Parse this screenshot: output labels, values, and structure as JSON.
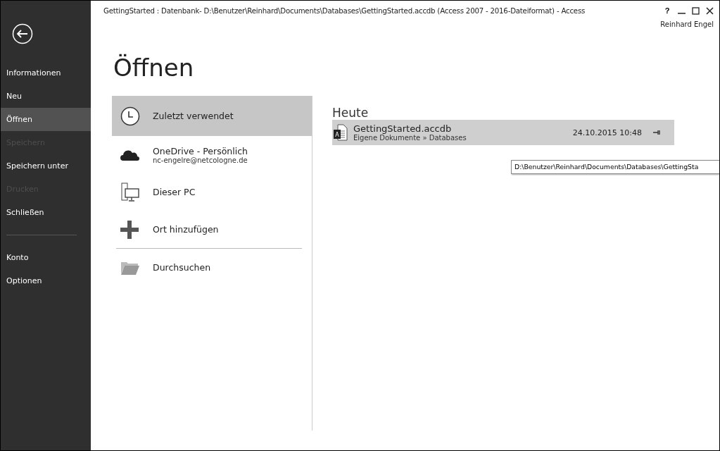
{
  "window": {
    "title": "GettingStarted : Datenbank- D:\\Benutzer\\Reinhard\\Documents\\Databases\\GettingStarted.accdb (Access 2007 - 2016-Dateiformat) - Access",
    "help": "?",
    "user": "Reinhard Engel"
  },
  "sidebar": {
    "items": [
      {
        "label": "Informationen",
        "selected": false,
        "disabled": false
      },
      {
        "label": "Neu",
        "selected": false,
        "disabled": false
      },
      {
        "label": "Öffnen",
        "selected": true,
        "disabled": false
      },
      {
        "label": "Speichern",
        "selected": false,
        "disabled": true
      },
      {
        "label": "Speichern unter",
        "selected": false,
        "disabled": false
      },
      {
        "label": "Drucken",
        "selected": false,
        "disabled": true
      },
      {
        "label": "Schließen",
        "selected": false,
        "disabled": false
      }
    ],
    "lower_items": [
      {
        "label": "Konto",
        "selected": false,
        "disabled": false
      },
      {
        "label": "Optionen",
        "selected": false,
        "disabled": false
      }
    ]
  },
  "page_title": "Öffnen",
  "places": [
    {
      "kind": "clock",
      "label": "Zuletzt verwendet",
      "selected": true
    },
    {
      "kind": "cloud",
      "label": "OneDrive - Persönlich",
      "sublabel": "nc-engelre@netcologne.de",
      "selected": false
    },
    {
      "kind": "pc",
      "label": "Dieser PC",
      "selected": false
    },
    {
      "kind": "plus",
      "label": "Ort hinzufügen",
      "selected": false
    },
    {
      "kind": "folder",
      "label": "Durchsuchen",
      "selected": false
    }
  ],
  "recent": {
    "group": "Heute",
    "files": [
      {
        "name": "GettingStarted.accdb",
        "path": "Eigene Dokumente » Databases",
        "date": "24.10.2015 10:48",
        "icon_letter": "A",
        "selected": true
      }
    ],
    "tooltip": "D:\\Benutzer\\Reinhard\\Documents\\Databases\\GettingSta"
  }
}
